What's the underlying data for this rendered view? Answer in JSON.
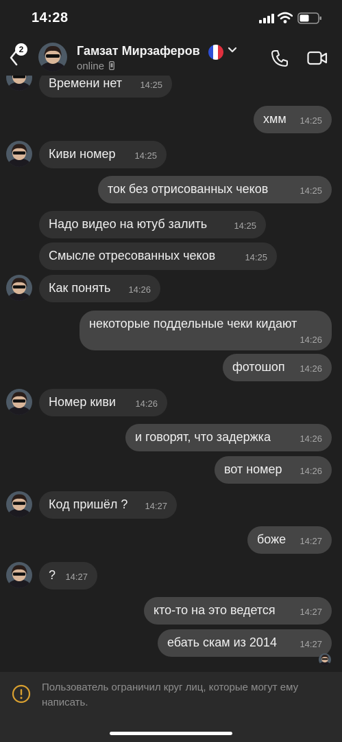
{
  "status_bar": {
    "time": "14:28"
  },
  "header": {
    "back_badge": "2",
    "name": "Гамзат Мирзаферов",
    "status": "online",
    "icons": [
      "back-chevron-icon",
      "flag-france-icon",
      "chevron-down-icon",
      "phone-icon",
      "video-camera-icon"
    ]
  },
  "messages": [
    {
      "direction": "in",
      "text": "Времени нет",
      "time": "14:25"
    },
    {
      "direction": "out",
      "text": "хмм",
      "time": "14:25"
    },
    {
      "direction": "in",
      "text": "Киви номер",
      "time": "14:25"
    },
    {
      "direction": "out",
      "text": "ток без отрисованных чеков",
      "time": "14:25"
    },
    {
      "direction": "in",
      "text": "Надо видео на ютуб залить",
      "time": "14:25"
    },
    {
      "direction": "in",
      "text": "Смысле отресованных чеков",
      "time": "14:25"
    },
    {
      "direction": "in",
      "text": "Как понять",
      "time": "14:26"
    },
    {
      "direction": "out",
      "text": "некоторые поддельные чеки кидают",
      "time": "14:26"
    },
    {
      "direction": "out",
      "text": "фотошоп",
      "time": "14:26"
    },
    {
      "direction": "in",
      "text": "Номер киви",
      "time": "14:26"
    },
    {
      "direction": "out",
      "text": "и говорят, что задержка",
      "time": "14:26"
    },
    {
      "direction": "out",
      "text": "вот номер",
      "time": "14:26"
    },
    {
      "direction": "in",
      "text": "Код пришёл ?",
      "time": "14:27"
    },
    {
      "direction": "out",
      "text": "боже",
      "time": "14:27"
    },
    {
      "direction": "in",
      "text": "?",
      "time": "14:27"
    },
    {
      "direction": "out",
      "text": "кто-то на это ведется",
      "time": "14:27"
    },
    {
      "direction": "out",
      "text": "ебать скам из 2014",
      "time": "14:27"
    }
  ],
  "notice": {
    "icon": "warning-circle-icon",
    "text": "Пользователь ограничил круг лиц, которые могут ему написать."
  },
  "colors": {
    "background": "#1f1f1f",
    "incoming_bubble": "#313131",
    "outgoing_bubble": "#454545",
    "notice_icon": "#d9a030"
  }
}
